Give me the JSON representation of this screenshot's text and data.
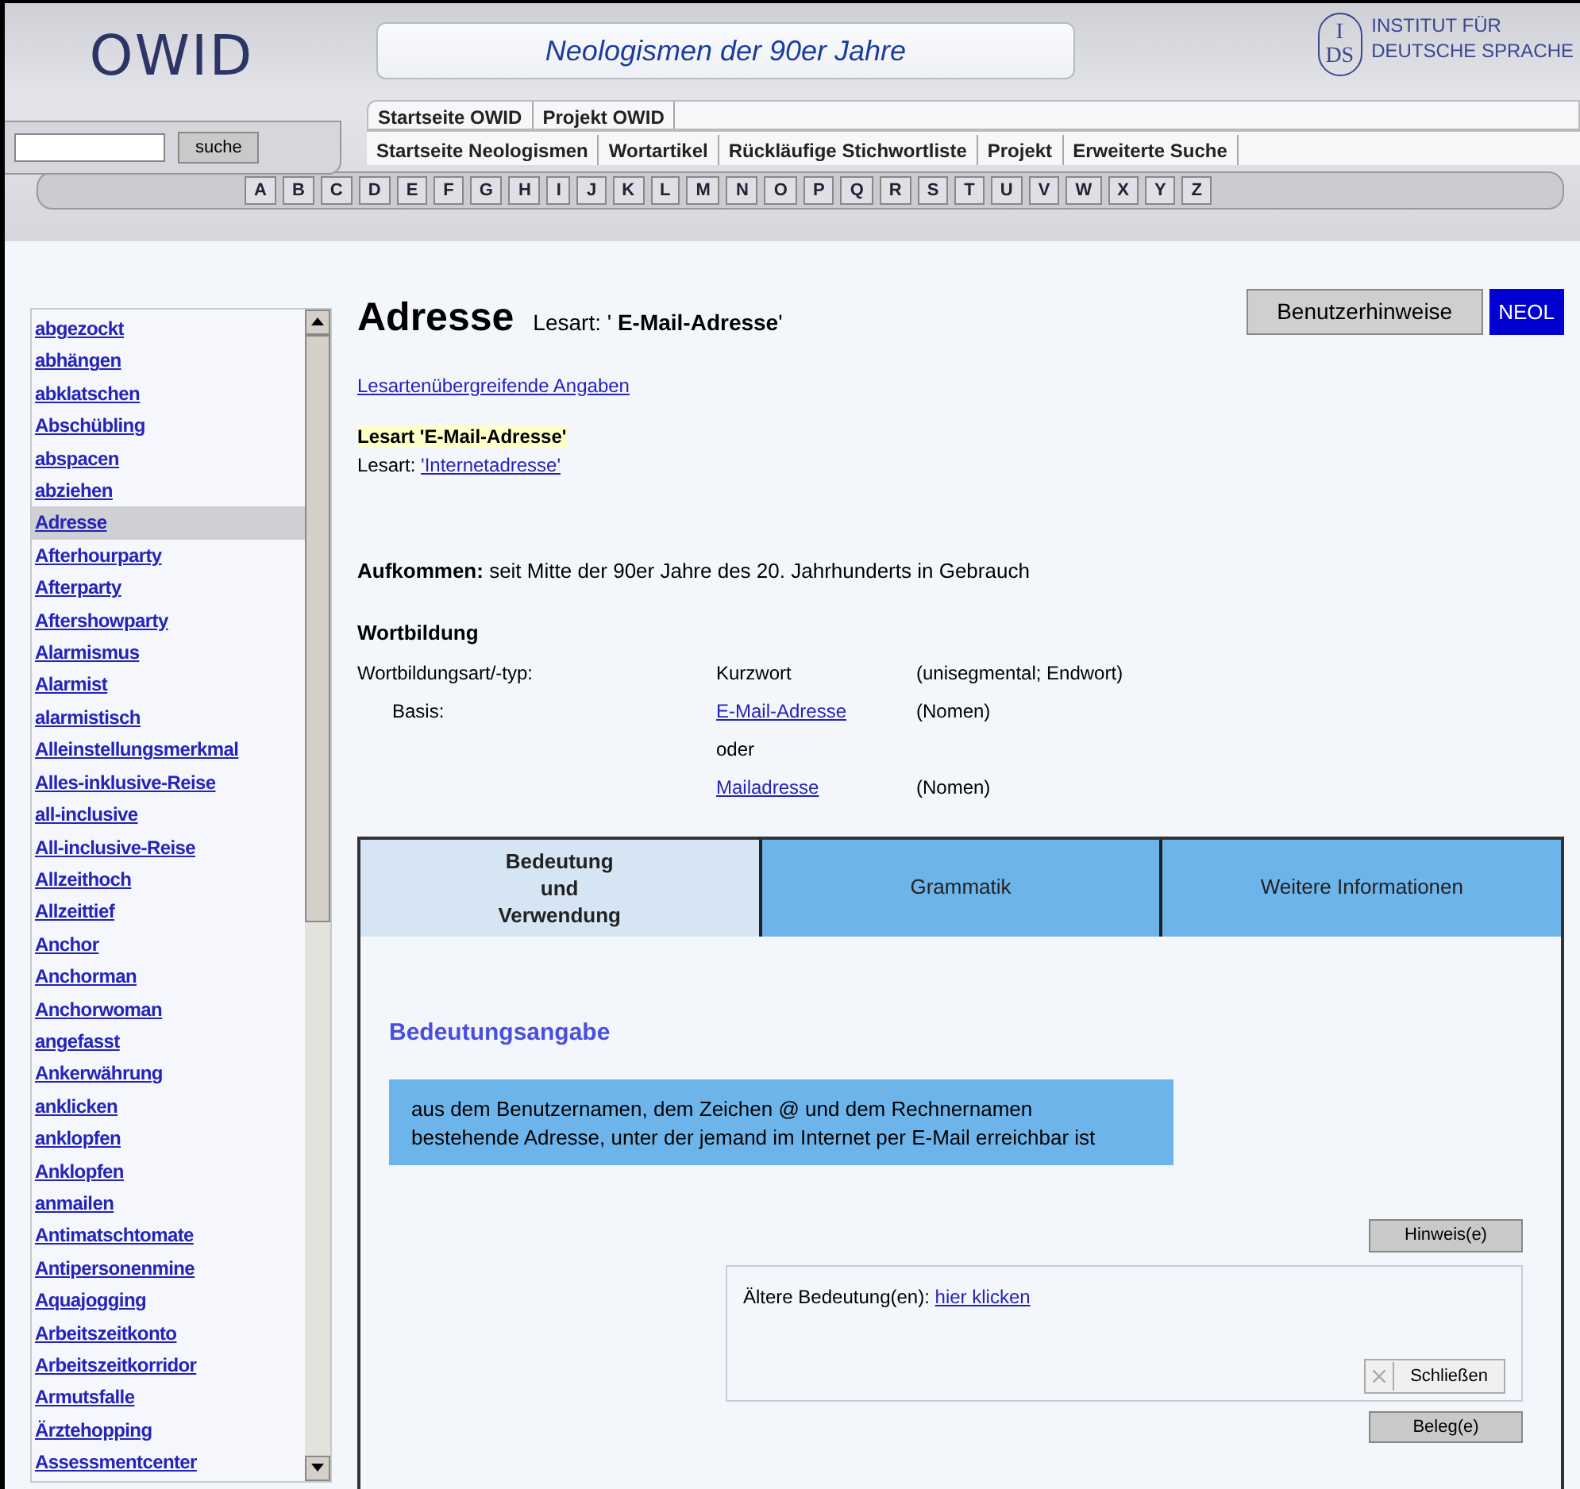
{
  "header": {
    "logo": "OWID",
    "title": "Neologismen der 90er Jahre",
    "institute_mark_top": "I",
    "institute_mark_bottom": "DS",
    "institute_lines": [
      "INSTITUT FÜR",
      "DEUTSCHE SPRACHE"
    ]
  },
  "nav_top": [
    "Startseite OWID",
    "Projekt OWID"
  ],
  "search": {
    "button": "suche"
  },
  "nav_main": [
    "Startseite Neologismen",
    "Wortartikel",
    "Rückläufige Stichwortliste",
    "Projekt",
    "Erweiterte Suche"
  ],
  "alphabet": [
    "A",
    "B",
    "C",
    "D",
    "E",
    "F",
    "G",
    "H",
    "I",
    "J",
    "K",
    "L",
    "M",
    "N",
    "O",
    "P",
    "Q",
    "R",
    "S",
    "T",
    "U",
    "V",
    "W",
    "X",
    "Y",
    "Z"
  ],
  "sidebar": {
    "items": [
      {
        "label": "abgezockt",
        "selected": false
      },
      {
        "label": "abhängen",
        "selected": false
      },
      {
        "label": "abklatschen",
        "selected": false
      },
      {
        "label": "Abschübling",
        "selected": false
      },
      {
        "label": "abspacen",
        "selected": false
      },
      {
        "label": "abziehen",
        "selected": false
      },
      {
        "label": "Adresse",
        "selected": true
      },
      {
        "label": "Afterhourparty",
        "selected": false
      },
      {
        "label": "Afterparty",
        "selected": false
      },
      {
        "label": "Aftershowparty",
        "selected": false
      },
      {
        "label": "Alarmismus",
        "selected": false
      },
      {
        "label": "Alarmist",
        "selected": false
      },
      {
        "label": "alarmistisch",
        "selected": false
      },
      {
        "label": "Alleinstellungsmerkmal",
        "selected": false
      },
      {
        "label": "Alles-inklusive-Reise",
        "selected": false
      },
      {
        "label": "all-inclusive",
        "selected": false
      },
      {
        "label": "All-inclusive-Reise",
        "selected": false
      },
      {
        "label": "Allzeithoch",
        "selected": false
      },
      {
        "label": "Allzeittief",
        "selected": false
      },
      {
        "label": "Anchor",
        "selected": false
      },
      {
        "label": "Anchorman",
        "selected": false
      },
      {
        "label": "Anchorwoman",
        "selected": false
      },
      {
        "label": "angefasst",
        "selected": false
      },
      {
        "label": "Ankerwährung",
        "selected": false
      },
      {
        "label": "anklicken",
        "selected": false
      },
      {
        "label": "anklopfen",
        "selected": false
      },
      {
        "label": "Anklopfen",
        "selected": false
      },
      {
        "label": "anmailen",
        "selected": false
      },
      {
        "label": "Antimatschtomate",
        "selected": false
      },
      {
        "label": "Antipersonenmine",
        "selected": false
      },
      {
        "label": "Aquajogging",
        "selected": false
      },
      {
        "label": "Arbeitszeitkonto",
        "selected": false
      },
      {
        "label": "Arbeitszeitkorridor",
        "selected": false
      },
      {
        "label": "Armutsfalle",
        "selected": false
      },
      {
        "label": "Ärztehopping",
        "selected": false
      },
      {
        "label": "Assessmentcenter",
        "selected": false
      }
    ]
  },
  "entry": {
    "headword": "Adresse",
    "lesart": "Lesart: ' **E-Mail-Adresse**'",
    "buttons": [
      "Benutzerhinweise",
      "NEOL"
    ],
    "overview_link": "Lesartenübergreifende Angaben",
    "lesarten": [
      {
        "prefix": "Lesart",
        "name": "'E-Mail-Adresse'",
        "selected": true
      },
      {
        "prefix": "Lesart:",
        "name": "'Internetadresse'",
        "selected": false
      }
    ],
    "aufkommen": {
      "label": "Aufkommen:",
      "text": "seit Mitte der 90er Jahre des 20. Jahrhunderts in Gebrauch"
    },
    "wortbildung": {
      "heading": "Wortbildung",
      "type_label": "Wortbildungsart/-typ:",
      "type_value": "Kurzwort",
      "type_note": "(unisegmental; Endwort)",
      "basis_label": "Basis:",
      "basis": [
        {
          "kind": "link",
          "text": "E-Mail-Adresse",
          "note": "(Nomen)"
        },
        {
          "kind": "text",
          "text": "oder"
        },
        {
          "kind": "link",
          "text": "Mailadresse",
          "note": "(Nomen)"
        }
      ]
    }
  },
  "tabs": [
    {
      "label": "Bedeutung und Verwendung",
      "selected": true
    },
    {
      "label": "Grammatik",
      "selected": false
    },
    {
      "label": "Weitere Informationen",
      "selected": false
    }
  ],
  "panel": {
    "heading": "Bedeutungsangabe",
    "definition": "aus dem Benutzernamen, dem Zeichen @ und dem Rechnernamen bestehende Adresse, unter der jemand im Internet per E-Mail erreichbar ist",
    "hint_button": "Hinweis(e)",
    "older_label": "Ältere Bedeutung(en):",
    "older_link": "hier klicken",
    "close_button": "Schließen",
    "evidence_button": "Beleg(e)"
  }
}
